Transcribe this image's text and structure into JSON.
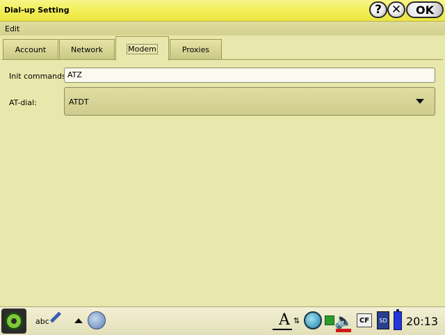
{
  "window": {
    "title": "Dial-up Setting",
    "buttons": {
      "help": "?",
      "close": "✕",
      "ok": "OK"
    }
  },
  "menu": {
    "items": [
      "Edit"
    ]
  },
  "tabs": [
    {
      "label": "Account",
      "active": false
    },
    {
      "label": "Network",
      "active": false
    },
    {
      "label": "Modem",
      "active": true
    },
    {
      "label": "Proxies",
      "active": false
    }
  ],
  "form": {
    "init_commands": {
      "label": "Init commands:",
      "value": "ATZ"
    },
    "at_dial": {
      "label": "AT-dial:",
      "selected": "ATDT"
    }
  },
  "taskbar": {
    "input_method": "abc",
    "font_glyph": "A",
    "swap_glyph": "⇅",
    "speaker_glyph": "🔈",
    "cf_label": "CF",
    "sd_label": "SD",
    "clock": "20:13"
  },
  "colors": {
    "background": "#e9e8ac",
    "titlebar": "#f3ef5c",
    "battery": "#2336d8",
    "volume_bar": "#d01818"
  }
}
